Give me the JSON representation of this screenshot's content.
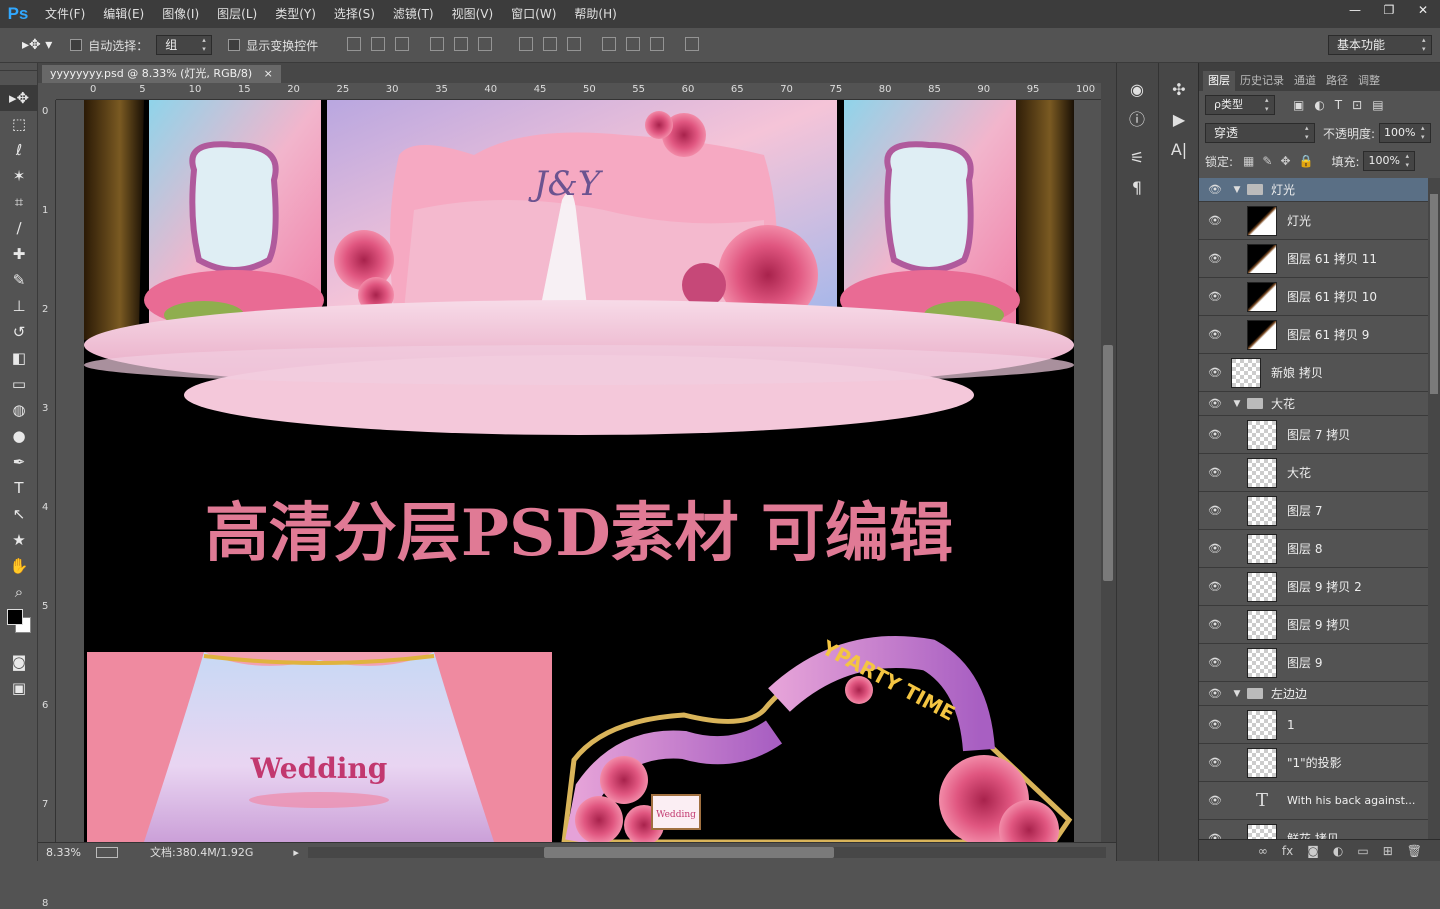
{
  "app": {
    "logo": "Ps",
    "window_controls": [
      "—",
      "❐",
      "✕"
    ]
  },
  "menu": [
    "文件(F)",
    "编辑(E)",
    "图像(I)",
    "图层(L)",
    "类型(Y)",
    "选择(S)",
    "滤镜(T)",
    "视图(V)",
    "窗口(W)",
    "帮助(H)"
  ],
  "options": {
    "auto_select_label": "自动选择：",
    "auto_select_value": "组",
    "transform_label": "显示变换控件",
    "workspace": "基本功能"
  },
  "document": {
    "tab_title": "yyyyyyyy.psd @ 8.33% (灯光, RGB/8)",
    "close": "×",
    "zoom": "8.33%",
    "doc_info": "文档:380.4M/1.92G"
  },
  "ruler_top": [
    "0",
    "5",
    "10",
    "15",
    "20",
    "25",
    "30",
    "35",
    "40",
    "45",
    "50",
    "55",
    "60",
    "65",
    "70",
    "75",
    "80",
    "85",
    "90",
    "95",
    "100"
  ],
  "ruler_left": [
    "0",
    "1",
    "2",
    "3",
    "4",
    "5",
    "6",
    "7",
    "8"
  ],
  "artwork": {
    "headline": "高清分层PSD素材 可编辑",
    "monogram": "J&Y",
    "wedding_text": "Wedding",
    "arch_text": "YPARTY TIME",
    "small_board": "Wedding"
  },
  "layers_panel": {
    "tabs": [
      "图层",
      "历史记录",
      "通道",
      "路径",
      "调整"
    ],
    "filter_label": "ρ类型",
    "blend_mode": "穿透",
    "opacity_label": "不透明度:",
    "opacity": "100%",
    "lock_label": "锁定:",
    "fill_label": "填充:",
    "fill": "100%",
    "layers": [
      {
        "name": "灯光",
        "type": "group",
        "indent": 0
      },
      {
        "name": "灯光",
        "type": "layer",
        "indent": 1
      },
      {
        "name": "图层 61 拷贝 11",
        "type": "layer",
        "indent": 1
      },
      {
        "name": "图层 61 拷贝 10",
        "type": "layer",
        "indent": 1
      },
      {
        "name": "图层 61 拷贝 9",
        "type": "layer",
        "indent": 1
      },
      {
        "name": "新娘 拷贝",
        "type": "layer",
        "indent": 0
      },
      {
        "name": "大花",
        "type": "group",
        "indent": 0
      },
      {
        "name": "图层 7 拷贝",
        "type": "layer",
        "indent": 1
      },
      {
        "name": "大花",
        "type": "layer",
        "indent": 1
      },
      {
        "name": "图层 7",
        "type": "layer",
        "indent": 1
      },
      {
        "name": "图层 8",
        "type": "layer",
        "indent": 1
      },
      {
        "name": "图层 9 拷贝 2",
        "type": "layer",
        "indent": 1
      },
      {
        "name": "图层 9 拷贝",
        "type": "layer",
        "indent": 1
      },
      {
        "name": "图层 9",
        "type": "layer",
        "indent": 1
      },
      {
        "name": "左边边",
        "type": "group",
        "indent": 0
      },
      {
        "name": "1",
        "type": "layer",
        "indent": 1
      },
      {
        "name": "\"1\"的投影",
        "type": "layer",
        "indent": 1
      },
      {
        "name": "With his back against...",
        "type": "text",
        "indent": 1
      },
      {
        "name": "鲜花 拷贝",
        "type": "layer",
        "indent": 1
      }
    ],
    "footer_icons": [
      "link-icon",
      "fx-icon",
      "mask-icon",
      "adjustment-icon",
      "folder-icon",
      "new-layer-icon",
      "trash-icon"
    ]
  },
  "colors": {
    "accent": "#31a8ff",
    "headline": "#e07a95",
    "selected_layer": "#5a6f85"
  }
}
